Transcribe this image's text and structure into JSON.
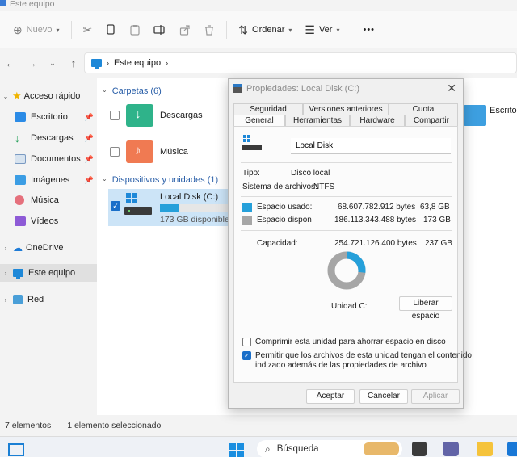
{
  "window": {
    "title": "Este equipo"
  },
  "commandbar": {
    "new_label": "Nuevo",
    "sort_label": "Ordenar",
    "view_label": "Ver",
    "more_label": "•••"
  },
  "address": {
    "location": "Este equipo"
  },
  "sidebar": {
    "items": [
      {
        "label": "Acceso rápido"
      },
      {
        "label": "Escritorio"
      },
      {
        "label": "Descargas"
      },
      {
        "label": "Documentos"
      },
      {
        "label": "Imágenes"
      },
      {
        "label": "Música"
      },
      {
        "label": "Vídeos"
      },
      {
        "label": "OneDrive"
      },
      {
        "label": "Este equipo"
      },
      {
        "label": "Red"
      }
    ]
  },
  "content": {
    "folders_header": "Carpetas (6)",
    "folders": [
      {
        "label": "Descargas"
      },
      {
        "label": "Música"
      }
    ],
    "partial_folder": "Escrito",
    "devices_header": "Dispositivos y unidades (1)",
    "drive": {
      "label": "Local Disk (C:)",
      "subtitle": "173 GB disponibles",
      "used_fraction": 0.27
    }
  },
  "status": {
    "items_count": "7 elementos",
    "selected": "1 elemento seleccionado"
  },
  "taskbar": {
    "search_label": "Búsqueda"
  },
  "dialog": {
    "title": "Propiedades: Local Disk (C:)",
    "tabs_row1": [
      "Seguridad",
      "Versiones anteriores",
      "Cuota"
    ],
    "tabs_row2": [
      "General",
      "Herramientas",
      "Hardware",
      "Compartir"
    ],
    "drive_name": "Local Disk",
    "type_label": "Tipo:",
    "type_value": "Disco local",
    "fs_label": "Sistema de archivos:",
    "fs_value": "NTFS",
    "used_label": "Espacio usado:",
    "used_bytes": "68.607.782.912 bytes",
    "used_gb": "63,8 GB",
    "free_label": "Espacio dispon",
    "free_bytes": "186.113.343.488 bytes",
    "free_gb": "173 GB",
    "cap_label": "Capacidad:",
    "cap_bytes": "254.721.126.400 bytes",
    "cap_gb": "237 GB",
    "unit_label": "Unidad C:",
    "cleanup_label": "Liberar espacio",
    "compress_label": "Comprimir esta unidad para ahorrar espacio en disco",
    "index_label_1": "Permitir que los archivos de esta unidad tengan el contenido",
    "index_label_2": "indizado además de las propiedades de archivo",
    "ok_label": "Aceptar",
    "cancel_label": "Cancelar",
    "apply_label": "Aplicar",
    "used_color": "#26a0da",
    "free_color": "#a6a6a6",
    "used_fraction": 0.2693
  }
}
